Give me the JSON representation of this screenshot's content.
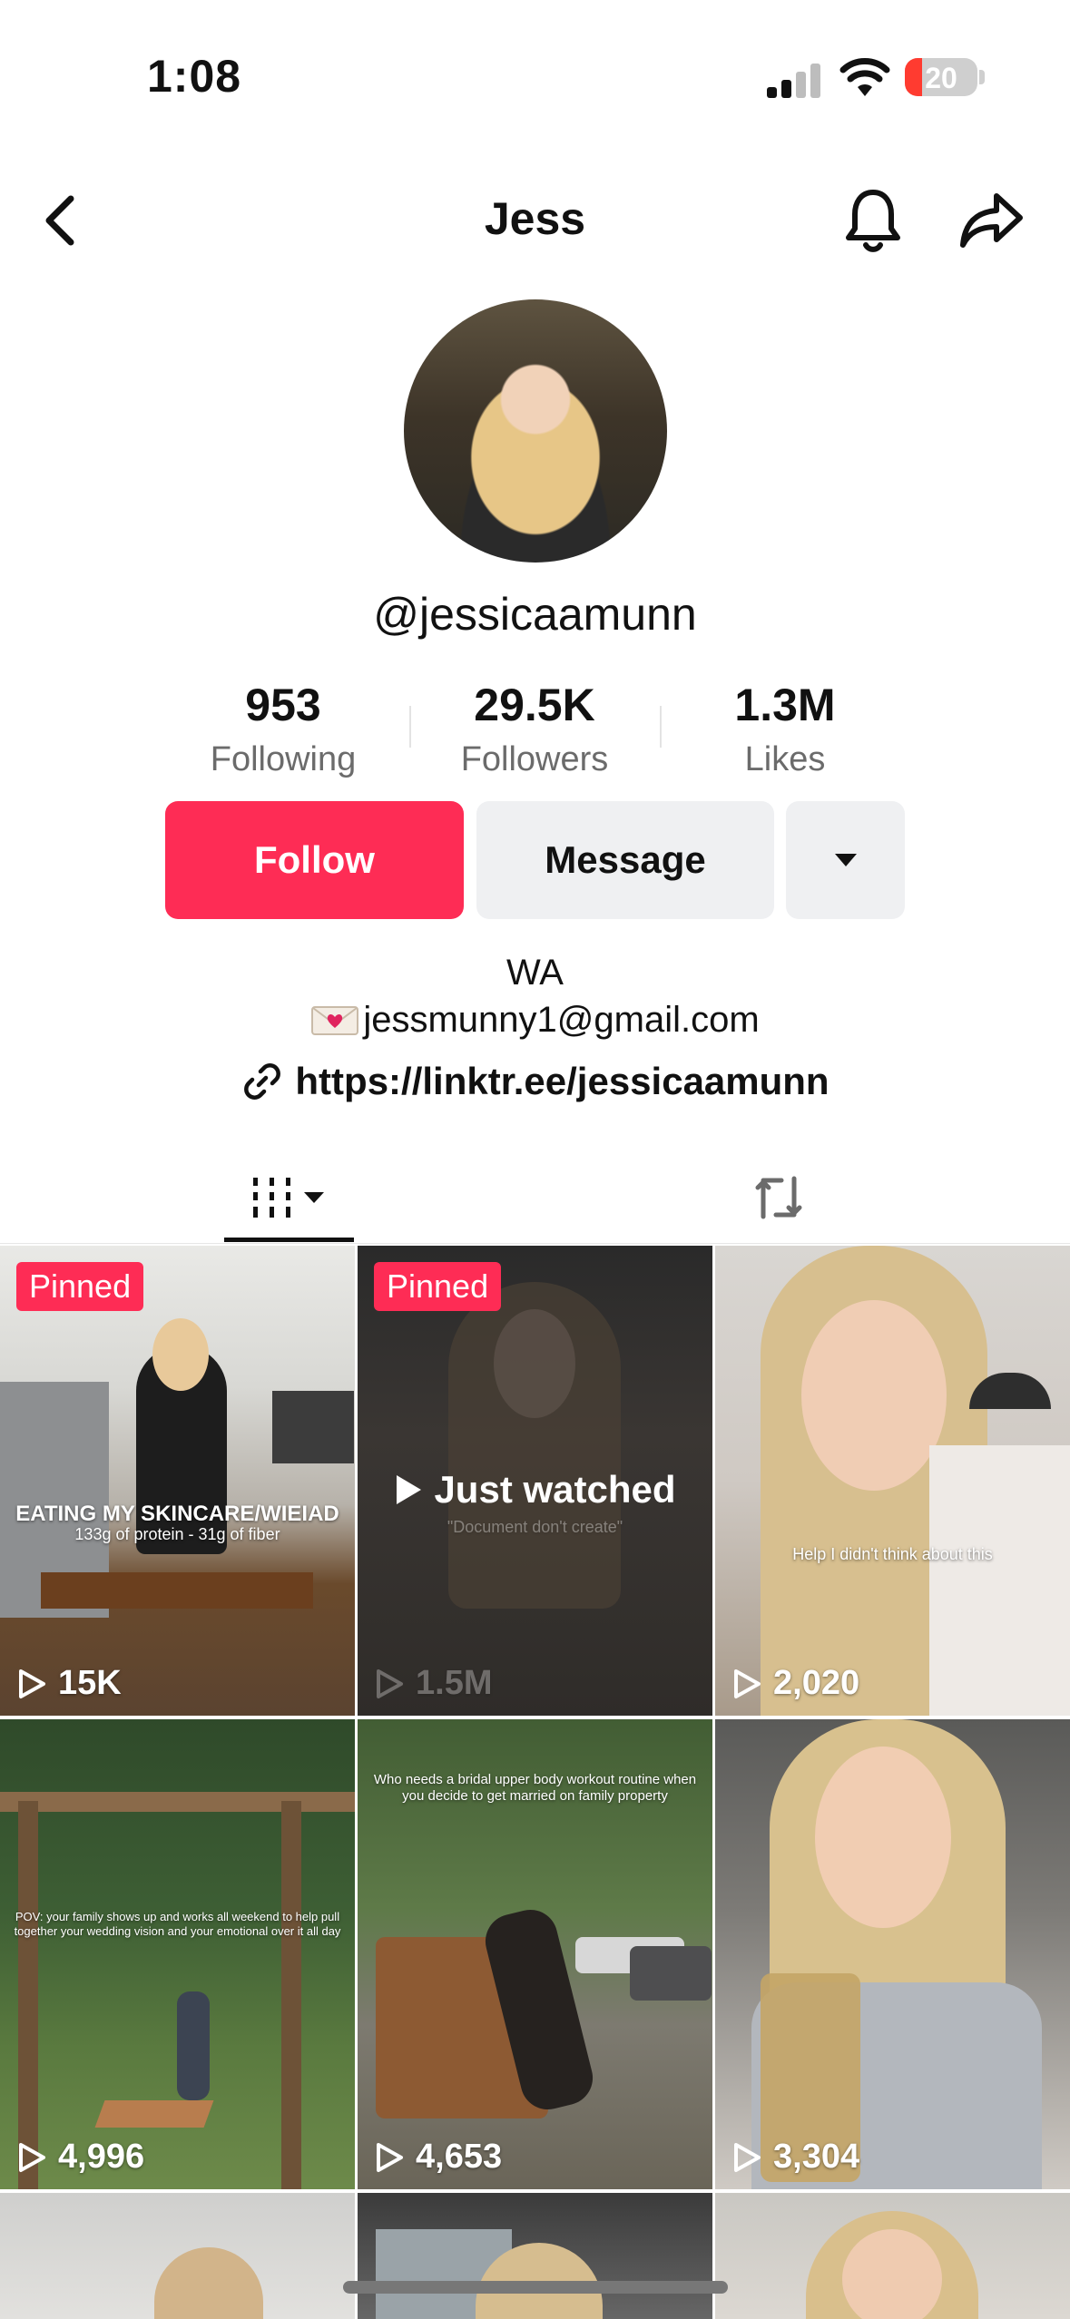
{
  "status": {
    "time": "1:08",
    "battery": "20"
  },
  "nav": {
    "title": "Jess"
  },
  "profile": {
    "username": "@jessicaamunn",
    "stats": [
      {
        "value": "953",
        "label": "Following"
      },
      {
        "value": "29.5K",
        "label": "Followers"
      },
      {
        "value": "1.3M",
        "label": "Likes"
      }
    ],
    "follow_label": "Follow",
    "message_label": "Message",
    "bio_line1": "WA",
    "bio_email": "jessmunny1@gmail.com",
    "link": "https://linktr.ee/jessicaamunn"
  },
  "videos": [
    {
      "pinned": "Pinned",
      "views": "15K",
      "caption": "EATING MY SKINCARE/WIEIAD",
      "subcaption": "133g of protein - 31g of fiber"
    },
    {
      "pinned": "Pinned",
      "views": "1.5M",
      "just_watched": "Just watched",
      "subcaption": "\"Document don't create\""
    },
    {
      "views": "2,020",
      "caption": "Help I didn't think about this"
    },
    {
      "views": "4,996",
      "caption": "POV: your family shows up and works all weekend to help pull together your wedding vision and your emotional over it all day"
    },
    {
      "views": "4,653",
      "caption": "Who needs a bridal upper body workout routine when you decide to get married on family property"
    },
    {
      "views": "3,304"
    }
  ],
  "colors": {
    "accent": "#fe2c55",
    "button_gray": "#eff0f2"
  },
  "icons": [
    "back-icon",
    "bell-icon",
    "share-icon",
    "grid-icon",
    "dropdown-icon",
    "repost-icon",
    "link-icon",
    "envelope-icon",
    "play-icon"
  ]
}
